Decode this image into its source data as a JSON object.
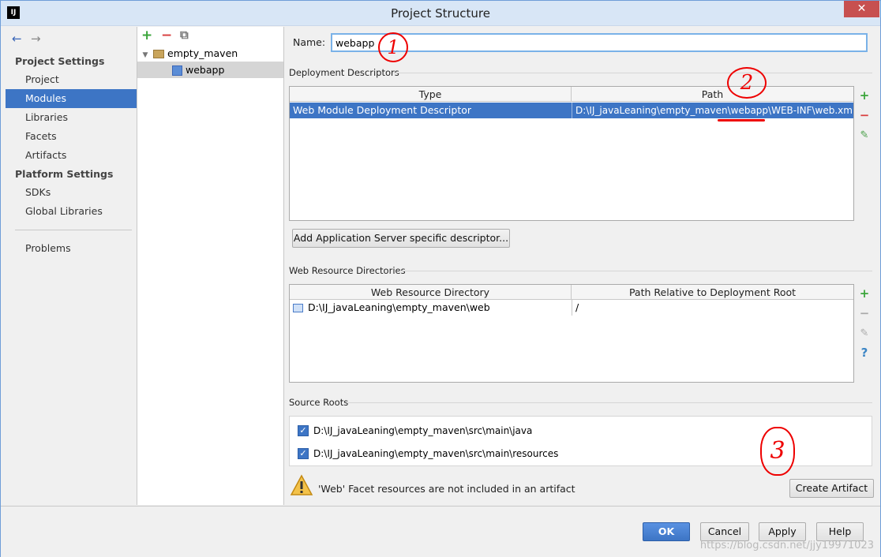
{
  "window": {
    "title": "Project Structure",
    "app_icon_text": "IJ",
    "close_glyph": "✕"
  },
  "nav": {
    "back_icon": "←",
    "forward_icon": "→",
    "project_settings_header": "Project Settings",
    "project_items": [
      "Project",
      "Modules",
      "Libraries",
      "Facets",
      "Artifacts"
    ],
    "platform_settings_header": "Platform Settings",
    "platform_items": [
      "SDKs",
      "Global Libraries"
    ],
    "problems_label": "Problems",
    "selected": "Modules"
  },
  "tree": {
    "add_icon": "+",
    "remove_icon": "−",
    "copy_icon": "⧉",
    "root": "empty_maven",
    "child": "webapp"
  },
  "main": {
    "name_label": "Name:",
    "name_value": "webapp",
    "deployment": {
      "section_title": "Deployment Descriptors",
      "col_type": "Type",
      "col_path": "Path",
      "row_type": "Web Module Deployment Descriptor",
      "row_path": "D:\\IJ_javaLeaning\\empty_maven\\webapp\\WEB-INF\\web.xml",
      "add_server_button": "Add Application Server specific descriptor..."
    },
    "web_resources": {
      "section_title": "Web Resource Directories",
      "col_dir": "Web Resource Directory",
      "col_rel": "Path Relative to Deployment Root",
      "row_dir": "D:\\IJ_javaLeaning\\empty_maven\\web",
      "row_rel": "/"
    },
    "source_roots": {
      "section_title": "Source Roots",
      "items": [
        "D:\\IJ_javaLeaning\\empty_maven\\src\\main\\java",
        "D:\\IJ_javaLeaning\\empty_maven\\src\\main\\resources"
      ]
    },
    "warning_text": "'Web' Facet resources are not included in an artifact",
    "create_artifact_button": "Create Artifact"
  },
  "buttons": {
    "ok": "OK",
    "cancel": "Cancel",
    "apply": "Apply",
    "help": "Help"
  },
  "annotations": {
    "one": "1",
    "two": "2",
    "three": "3"
  },
  "watermark": "https://blog.csdn.net/jjy19971023",
  "colors": {
    "accent": "#3d75c5",
    "annotation": "#e00000",
    "add_green": "#3aa53a",
    "remove_red": "#d93f3f"
  }
}
